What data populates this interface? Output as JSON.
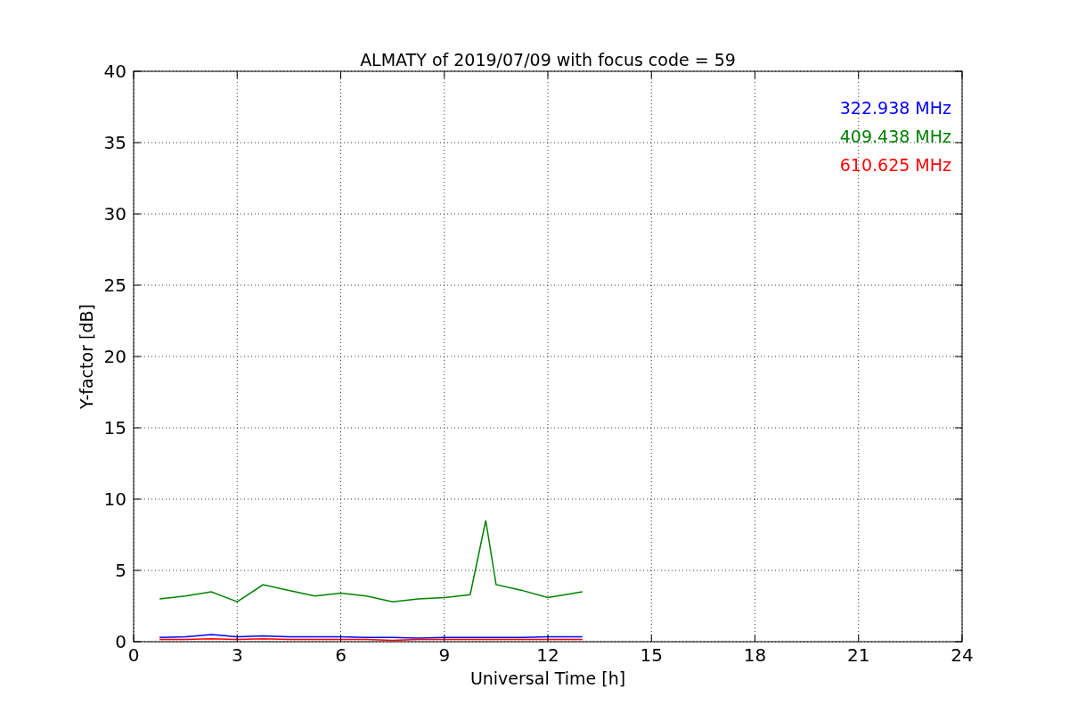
{
  "chart_data": {
    "type": "line",
    "title": "ALMATY of 2019/07/09 with focus code = 59",
    "xlabel": "Universal Time [h]",
    "ylabel": "Y-factor [dB]",
    "x": [
      0.75,
      1.5,
      2.25,
      3,
      3.75,
      4.5,
      5.25,
      6,
      6.75,
      7.5,
      8.25,
      9,
      9.75,
      10.2,
      10.5,
      11.25,
      12,
      13
    ],
    "series": [
      {
        "name": "322.938 MHz",
        "color": "#0000ff",
        "values": [
          0.3,
          0.35,
          0.5,
          0.35,
          0.4,
          0.35,
          0.35,
          0.35,
          0.3,
          0.3,
          0.25,
          0.3,
          0.3,
          0.3,
          0.3,
          0.3,
          0.35,
          0.35
        ]
      },
      {
        "name": "409.438 MHz",
        "color": "#008000",
        "values": [
          3,
          3.2,
          3.5,
          2.8,
          4,
          3.6,
          3.2,
          3.4,
          3.2,
          2.8,
          3,
          3.1,
          3.3,
          8.5,
          4,
          3.6,
          3.1,
          3.5
        ]
      },
      {
        "name": "610.625 MHz",
        "color": "#ff0000",
        "values": [
          0.15,
          0.15,
          0.2,
          0.15,
          0.2,
          0.15,
          0.15,
          0.15,
          0.15,
          0.1,
          0.15,
          0.15,
          0.15,
          0.15,
          0.15,
          0.15,
          0.15,
          0.15
        ]
      }
    ],
    "xlim": [
      0,
      24
    ],
    "ylim": [
      0,
      40
    ],
    "xticks": [
      0,
      3,
      6,
      9,
      12,
      15,
      18,
      21,
      24
    ],
    "yticks": [
      0,
      5,
      10,
      15,
      20,
      25,
      30,
      35,
      40
    ],
    "grid": true
  }
}
